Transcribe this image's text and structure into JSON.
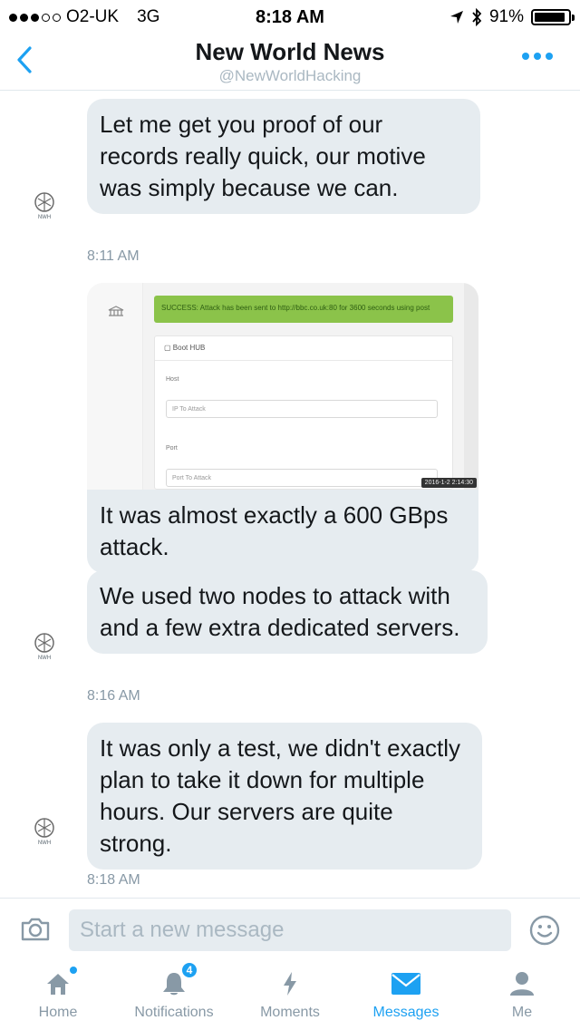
{
  "status_bar": {
    "carrier": "O2-UK",
    "network": "3G",
    "time": "8:18 AM",
    "battery": "91%",
    "battery_level": 0.91
  },
  "header": {
    "title": "New World News",
    "handle": "@NewWorldHacking"
  },
  "avatar_label": "NWH",
  "messages": [
    {
      "text": "Let me get you proof of our records really quick, our motive was simply because we can.",
      "time": "8:11 AM"
    },
    {
      "text": "It was almost exactly a 600 GBps attack."
    },
    {
      "text": "We used two nodes to attack with and a few extra dedicated servers.",
      "time": "8:16 AM"
    },
    {
      "text": "It was only a test, we didn't exactly plan to take it down for multiple hours. Our servers are quite strong.",
      "time": "8:18 AM"
    }
  ],
  "attachment": {
    "success_text": "SUCCESS: Attack has been sent to http://bbc.co.uk:80 for 3600 seconds using post",
    "panel_title": "Boot HUB",
    "host_label": "Host",
    "host_placeholder": "IP To Attack",
    "port_label": "Port",
    "port_placeholder": "Port To Attack",
    "stamp": "2016-1-2 2:14:30"
  },
  "composer": {
    "placeholder": "Start a new message"
  },
  "tabs": [
    {
      "label": "Home",
      "icon": "home-icon"
    },
    {
      "label": "Notifications",
      "icon": "bell-icon",
      "badge": "4"
    },
    {
      "label": "Moments",
      "icon": "lightning-icon"
    },
    {
      "label": "Messages",
      "icon": "envelope-icon",
      "active": true
    },
    {
      "label": "Me",
      "icon": "person-icon"
    }
  ],
  "colors": {
    "accent": "#1da1f2",
    "bubble": "#e6ecf0",
    "muted": "#8899a6"
  }
}
